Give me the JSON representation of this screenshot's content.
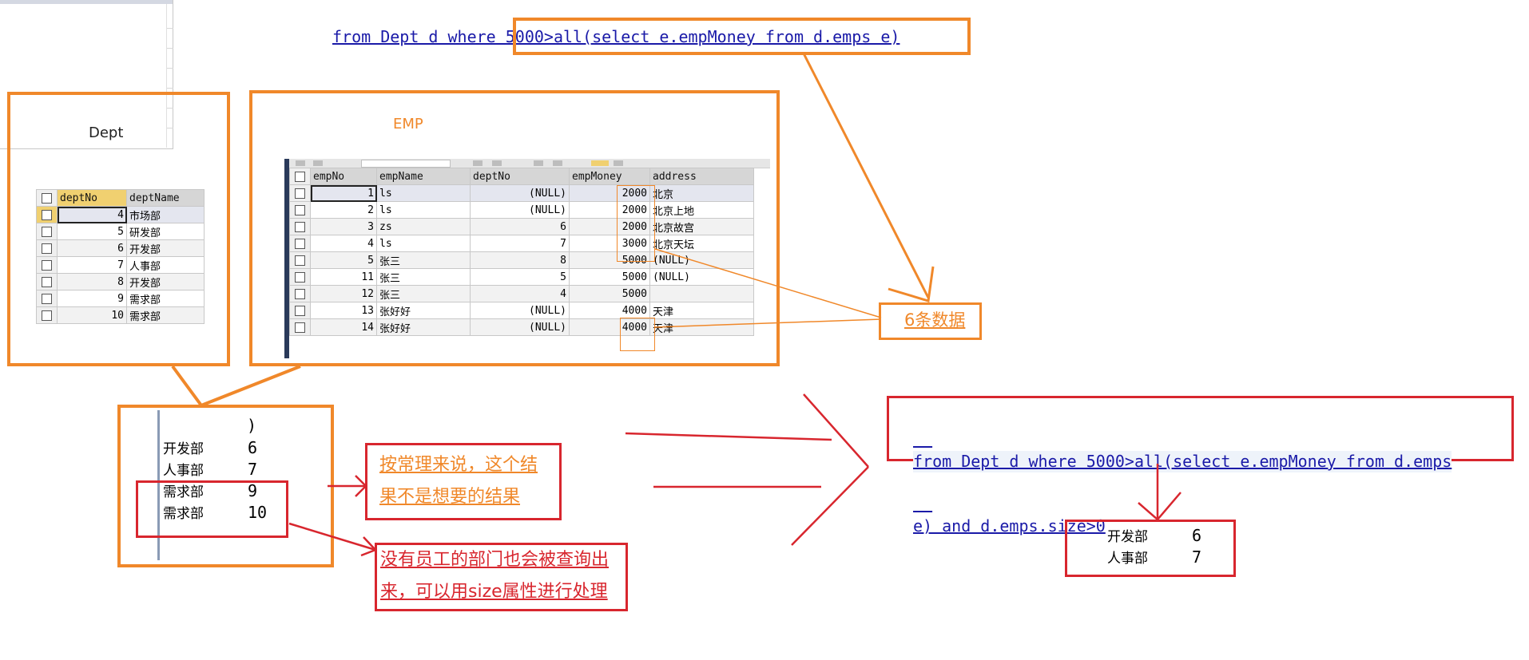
{
  "query1": "from Dept d where 5000>all(select e.empMoney from d.emps e)",
  "query2_line1": "from Dept d where 5000>all(select e.empMoney from d.emps",
  "query2_line2": "e) and d.emps.size>0",
  "dept_window_title": "Dept",
  "emp_label": "EMP",
  "dept_table": {
    "headers": [
      "deptNo",
      "deptName"
    ],
    "rows": [
      [
        "4",
        "市场部"
      ],
      [
        "5",
        "研发部"
      ],
      [
        "6",
        "开发部"
      ],
      [
        "7",
        "人事部"
      ],
      [
        "8",
        "开发部"
      ],
      [
        "9",
        "需求部"
      ],
      [
        "10",
        "需求部"
      ]
    ]
  },
  "emp_table": {
    "headers": [
      "empNo",
      "empName",
      "deptNo",
      "empMoney",
      "address"
    ],
    "rows": [
      [
        "1",
        "ls",
        "(NULL)",
        "2000",
        "北京"
      ],
      [
        "2",
        "ls",
        "(NULL)",
        "2000",
        "北京上地"
      ],
      [
        "3",
        "zs",
        "6",
        "2000",
        "北京故宫"
      ],
      [
        "4",
        "ls",
        "7",
        "3000",
        "北京天坛"
      ],
      [
        "5",
        "张三",
        "8",
        "5000",
        "(NULL)"
      ],
      [
        "11",
        "张三",
        "5",
        "5000",
        "(NULL)"
      ],
      [
        "12",
        "张三",
        "4",
        "5000",
        ""
      ],
      [
        "13",
        "张好好",
        "(NULL)",
        "4000",
        "天津"
      ],
      [
        "14",
        "张好好",
        "(NULL)",
        "4000",
        "天津"
      ]
    ]
  },
  "annotation_6rows": "6条数据",
  "result1": {
    "paren": ")",
    "rows": [
      [
        "开发部",
        "6"
      ],
      [
        "人事部",
        "7"
      ],
      [
        "需求部",
        "9"
      ],
      [
        "需求部",
        "10"
      ]
    ]
  },
  "note_unexpected_line1": "按常理来说，这个结",
  "note_unexpected_line2": "果不是想要的结果",
  "note_no_emp_line1": "没有员工的部门也会被查询出",
  "note_no_emp_line2": "来，可以用size属性进行处理",
  "result2": {
    "rows": [
      [
        "开发部",
        "6"
      ],
      [
        "人事部",
        "7"
      ]
    ]
  },
  "colors": {
    "orange": "#f0882a",
    "red": "#d8262e",
    "link_blue": "#1a1aa8"
  }
}
